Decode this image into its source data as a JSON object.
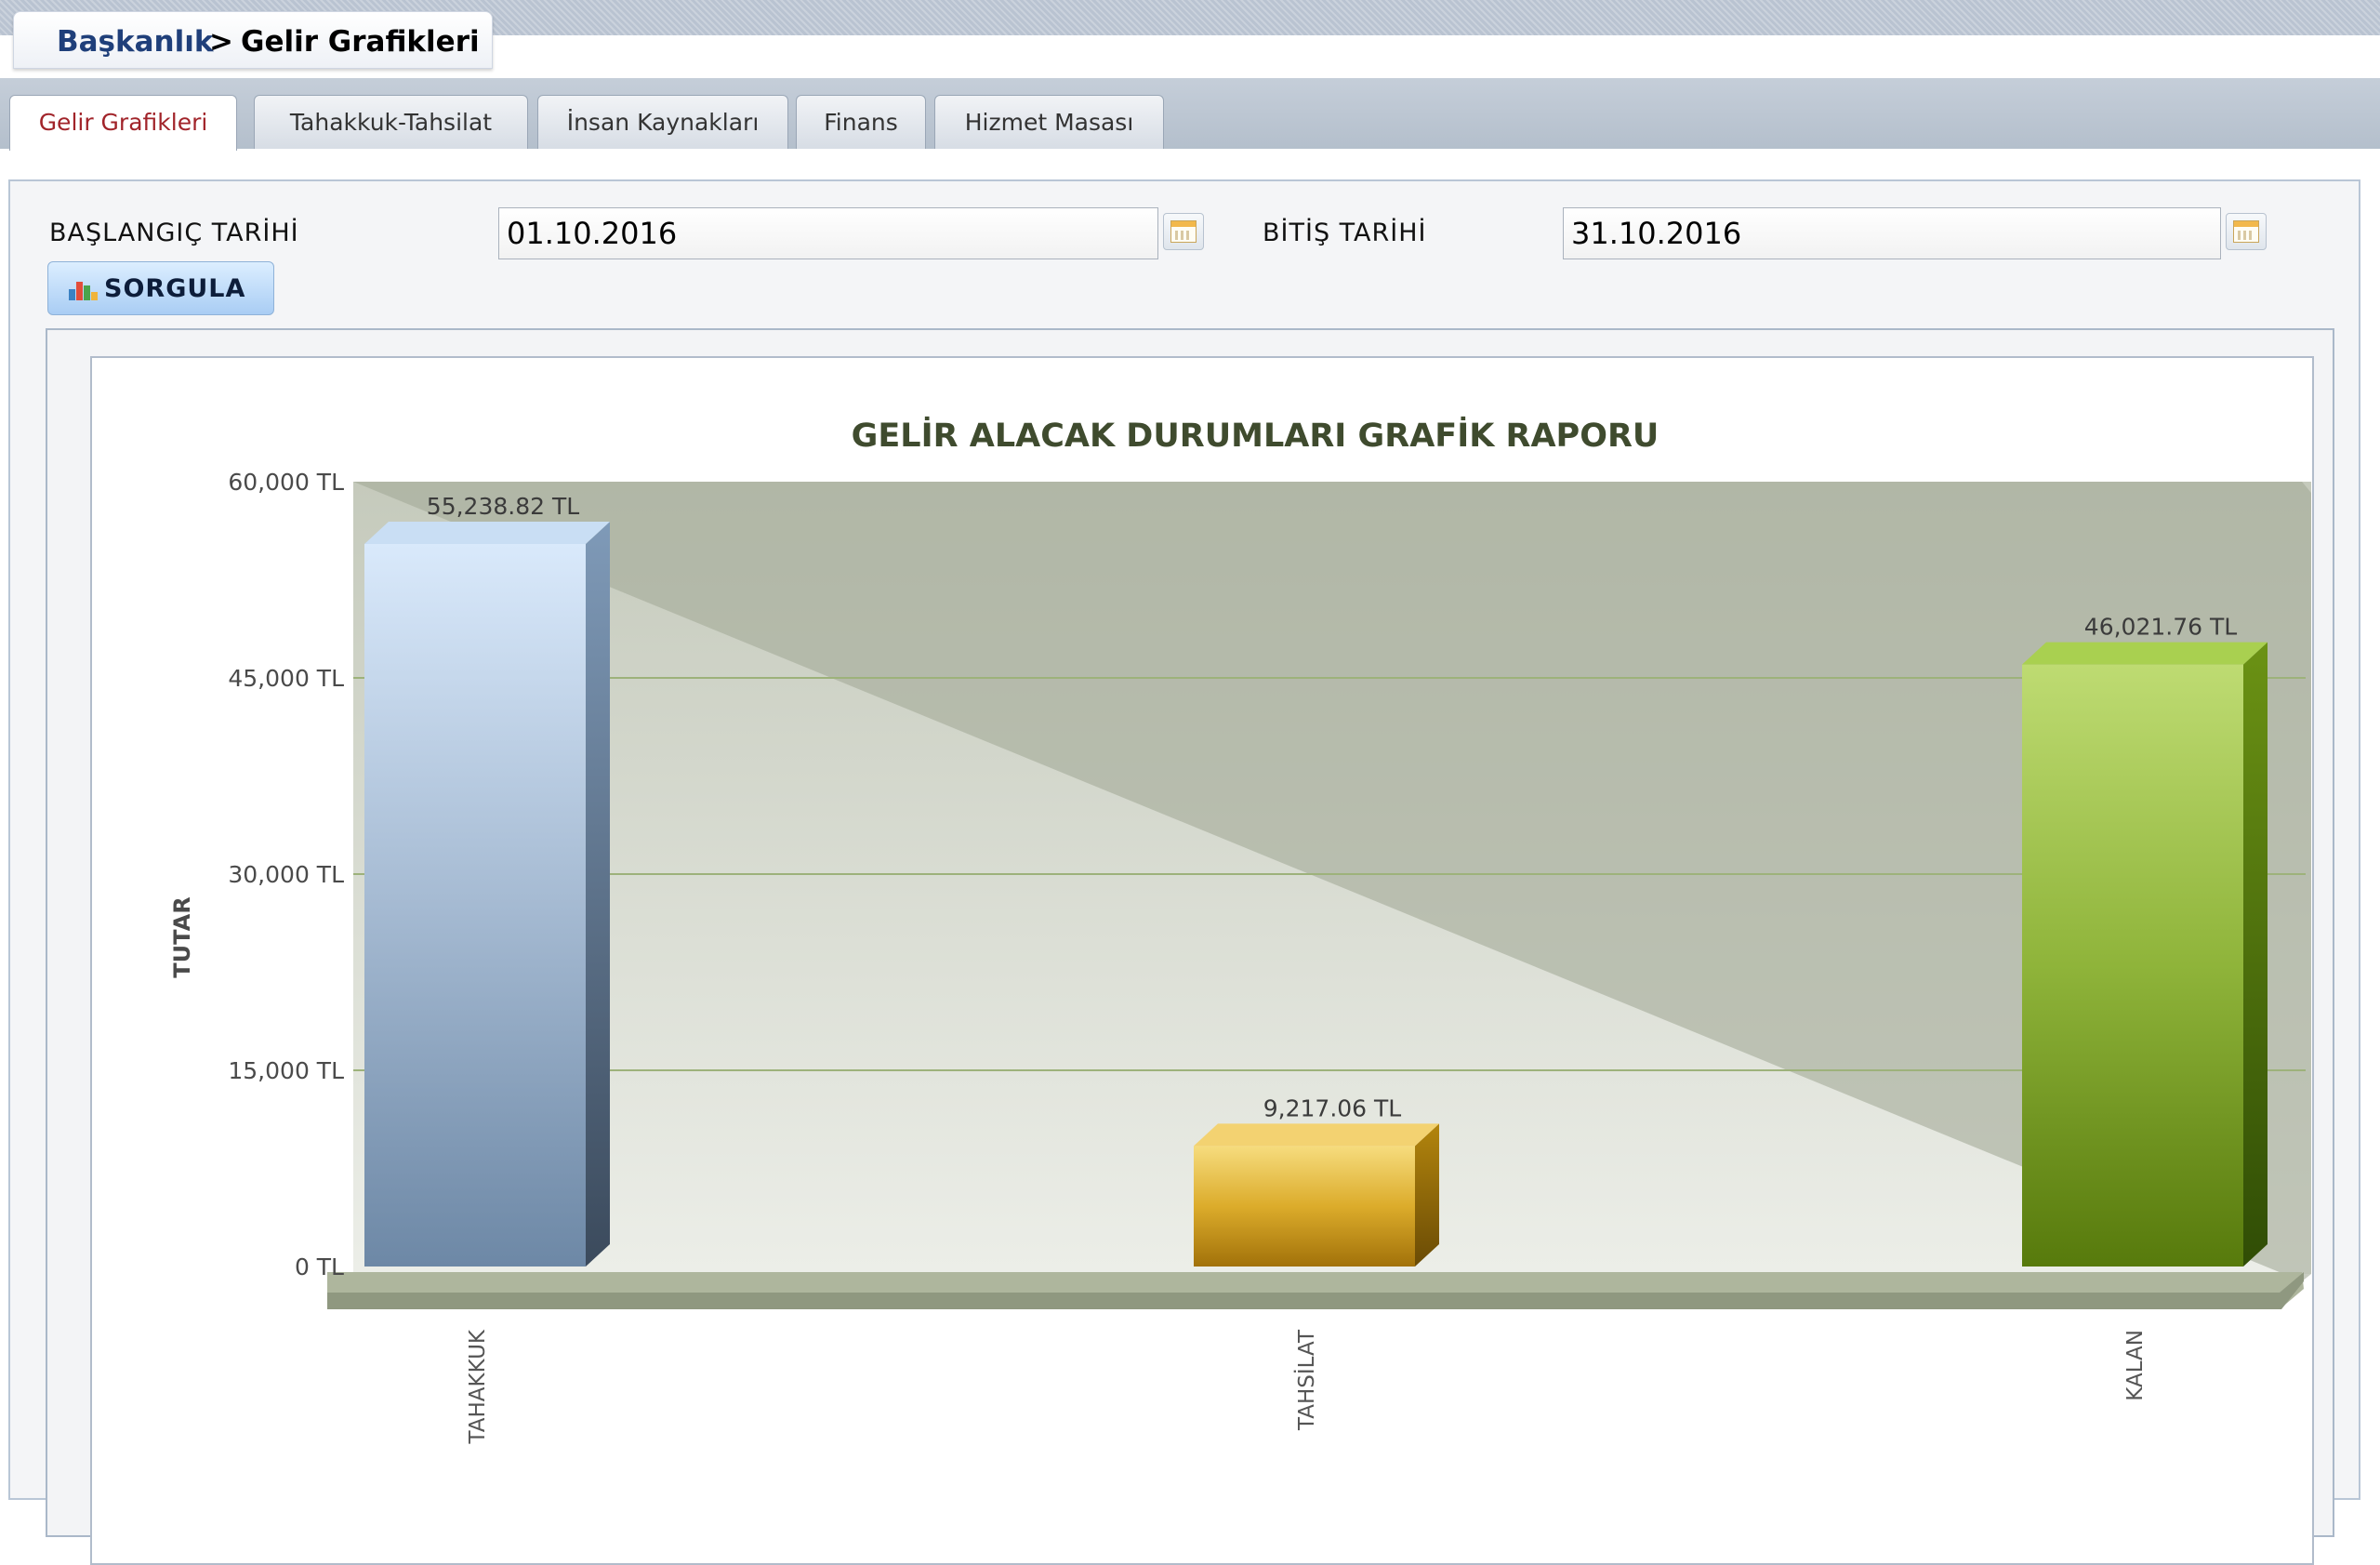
{
  "breadcrumb": {
    "home": "Başkanlık",
    "separator": ">",
    "current": "Gelir Grafikleri"
  },
  "tabs": [
    {
      "label": "Gelir Grafikleri",
      "active": true
    },
    {
      "label": "Tahakkuk-Tahsilat",
      "active": false
    },
    {
      "label": "İnsan Kaynakları",
      "active": false
    },
    {
      "label": "Finans",
      "active": false
    },
    {
      "label": "Hizmet Masası",
      "active": false
    }
  ],
  "form": {
    "start_label": "BAŞLANGIÇ TARİHİ",
    "start_value": "01.10.2016",
    "end_label": "BİTİŞ TARİHİ",
    "end_value": "31.10.2016",
    "query_button": "SORGULA",
    "calendar_icon": "calendar-icon",
    "query_icon": "bar-chart-icon"
  },
  "chart_data": {
    "type": "bar",
    "title": "GELİR ALACAK DURUMLARI GRAFİK RAPORU",
    "xlabel": "",
    "ylabel": "TUTAR",
    "ylim": [
      0,
      60000
    ],
    "yticks": [
      0,
      15000,
      30000,
      45000,
      60000
    ],
    "ytick_labels": [
      "0 TL",
      "15,000 TL",
      "30,000 TL",
      "45,000 TL",
      "60,000 TL"
    ],
    "categories": [
      "TAHAKKUK",
      "TAHSİLAT",
      "KALAN"
    ],
    "values": [
      55238.82,
      9217.06,
      46021.76
    ],
    "value_labels": [
      "55,238.82 TL",
      "9,217.06 TL",
      "46,021.76 TL"
    ],
    "colors": [
      "#8ea8c6",
      "#d7a51f",
      "#7ea52a"
    ],
    "grid": true,
    "legend": "none"
  }
}
